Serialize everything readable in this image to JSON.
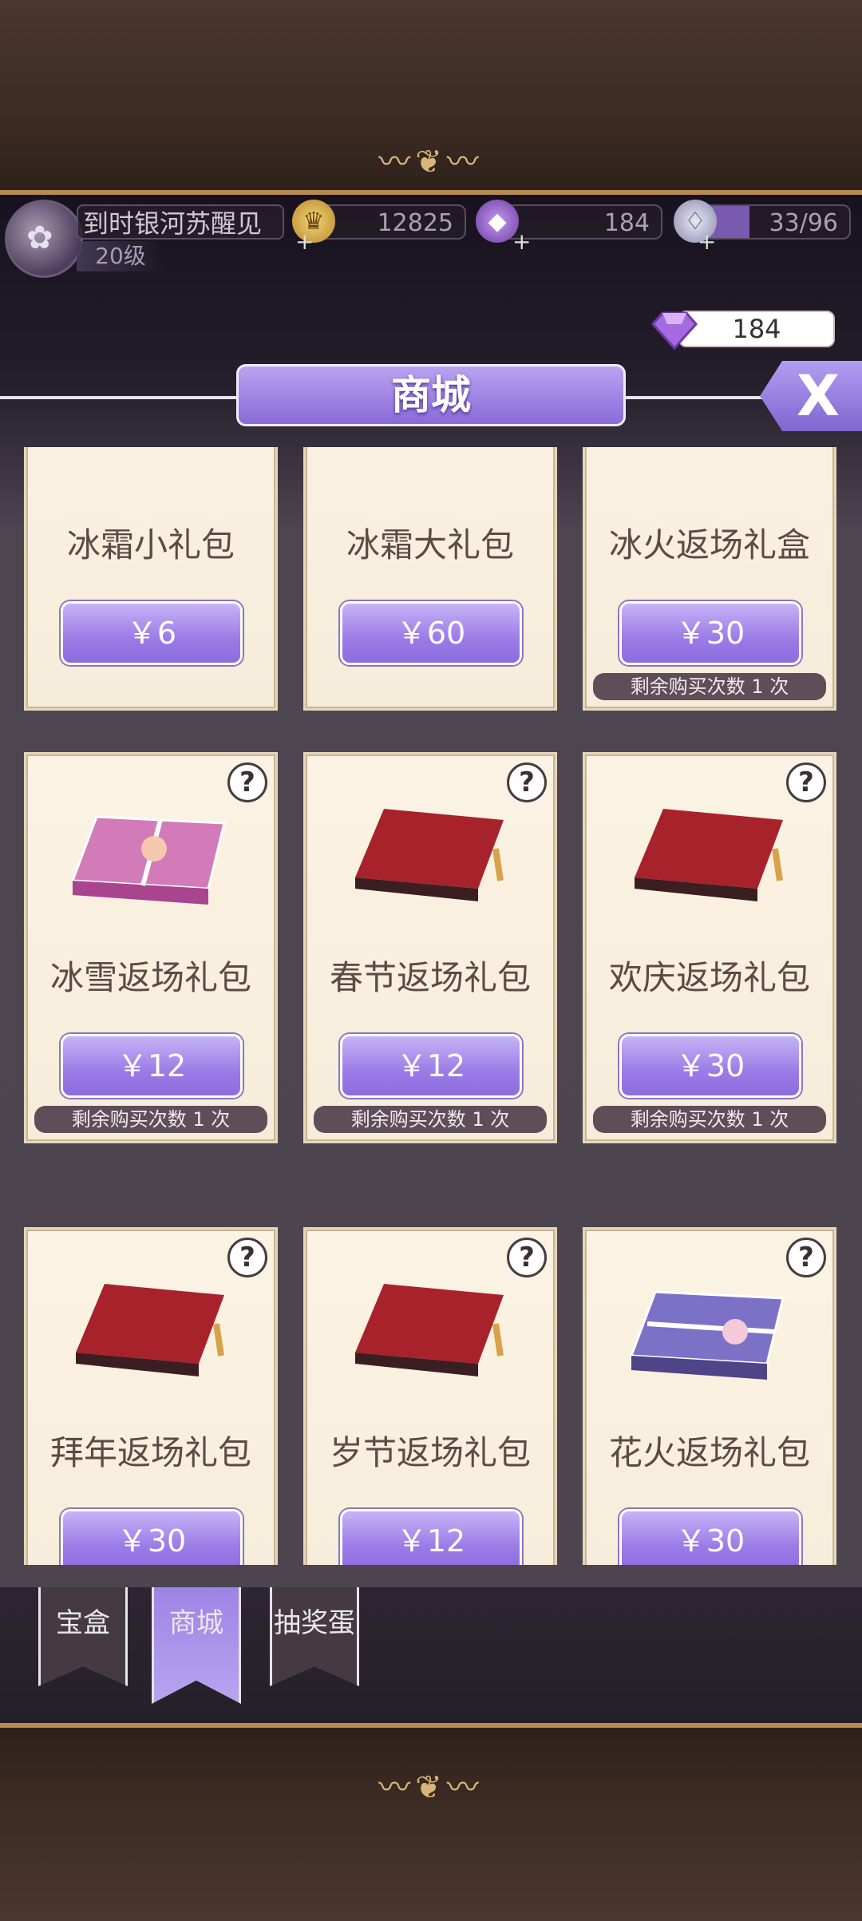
{
  "player": {
    "name": "到时银河苏醒见",
    "level": "20级"
  },
  "resources": {
    "coins": "12825",
    "gems": "184",
    "energy": "33/96"
  },
  "gem_balance": "184",
  "title": "商城",
  "close_label": "X",
  "items": [
    {
      "name": "冰霜小礼包",
      "price": "￥6",
      "remaining": ""
    },
    {
      "name": "冰霜大礼包",
      "price": "￥60",
      "remaining": ""
    },
    {
      "name": "冰火返场礼盒",
      "price": "￥30",
      "remaining": "剩余购买次数 1 次"
    },
    {
      "name": "冰雪返场礼包",
      "price": "￥12",
      "remaining": "剩余购买次数 1 次"
    },
    {
      "name": "春节返场礼包",
      "price": "￥12",
      "remaining": "剩余购买次数 1 次"
    },
    {
      "name": "欢庆返场礼包",
      "price": "￥30",
      "remaining": "剩余购买次数 1 次"
    },
    {
      "name": "拜年返场礼包",
      "price": "￥30",
      "remaining": ""
    },
    {
      "name": "岁节返场礼包",
      "price": "￥12",
      "remaining": ""
    },
    {
      "name": "花火返场礼包",
      "price": "￥30",
      "remaining": ""
    }
  ],
  "help_label": "?",
  "tabs": [
    {
      "label": "宝盒"
    },
    {
      "label": "商城"
    },
    {
      "label": "抽奖蛋"
    }
  ]
}
